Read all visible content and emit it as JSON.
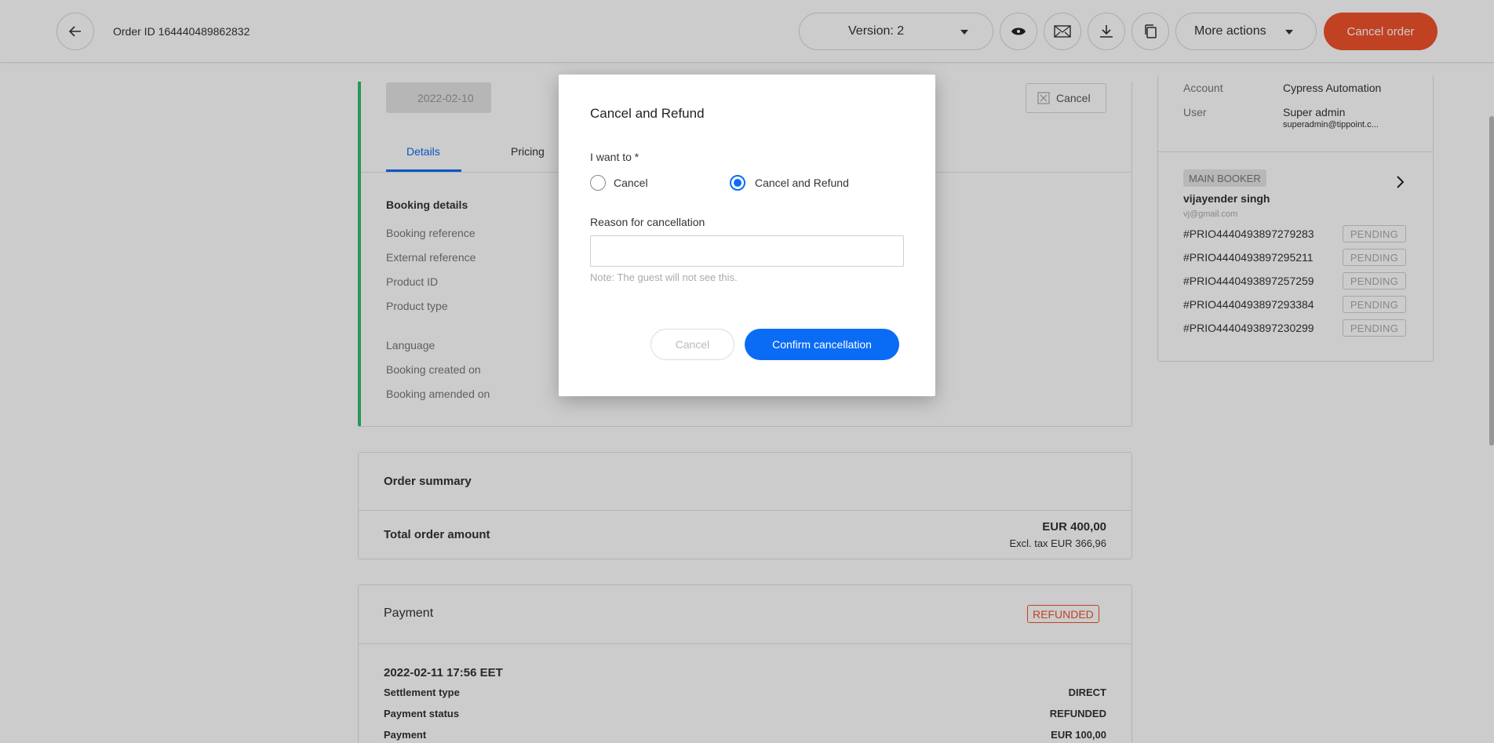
{
  "header": {
    "order_id": "Order ID 164440489862832",
    "version_label": "Version: 2",
    "more_actions": "More actions",
    "cancel_order": "Cancel order"
  },
  "booking": {
    "date": "2022-02-10",
    "cancel_label": "Cancel",
    "tabs": [
      "Details",
      "Pricing"
    ],
    "section_title": "Booking details",
    "labels": [
      "Booking reference",
      "External reference",
      "Product ID",
      "Product type",
      "Language",
      "Booking created on",
      "Booking amended on"
    ]
  },
  "order_summary": {
    "title": "Order summary",
    "total_label": "Total order amount",
    "total_value": "EUR 400,00",
    "excl_tax": "Excl. tax EUR 366,96"
  },
  "payment": {
    "title": "Payment",
    "badge": "REFUNDED",
    "timestamp": "2022-02-11 17:56 EET",
    "rows": [
      {
        "label": "Settlement type",
        "value": "DIRECT"
      },
      {
        "label": "Payment status",
        "value": "REFUNDED"
      },
      {
        "label": "Payment",
        "value": "EUR 100,00"
      }
    ]
  },
  "sidebar": {
    "account_label": "Account",
    "account_value": "Cypress Automation",
    "user_label": "User",
    "user_value": "Super admin",
    "user_email": "superadmin@tippoint.c...",
    "main_booker_badge": "MAIN BOOKER",
    "booker_name": "vijayender singh",
    "booker_email": "vj@gmail.com",
    "bookings": [
      {
        "ref": "#PRIO4440493897279283",
        "status": "PENDING"
      },
      {
        "ref": "#PRIO4440493897295211",
        "status": "PENDING"
      },
      {
        "ref": "#PRIO4440493897257259",
        "status": "PENDING"
      },
      {
        "ref": "#PRIO4440493897293384",
        "status": "PENDING"
      },
      {
        "ref": "#PRIO4440493897230299",
        "status": "PENDING"
      }
    ]
  },
  "modal": {
    "title": "Cancel and Refund",
    "question": "I want to *",
    "option_cancel": "Cancel",
    "option_refund": "Cancel and Refund",
    "selected": "Cancel and Refund",
    "reason_label": "Reason for cancellation",
    "reason_value": "",
    "note": "Note: The guest will not see this.",
    "cancel_button": "Cancel",
    "confirm_button": "Confirm cancellation"
  },
  "colors": {
    "accent": "#0a6cf5",
    "danger": "#f0532c",
    "status_bar": "#2fbf71"
  }
}
